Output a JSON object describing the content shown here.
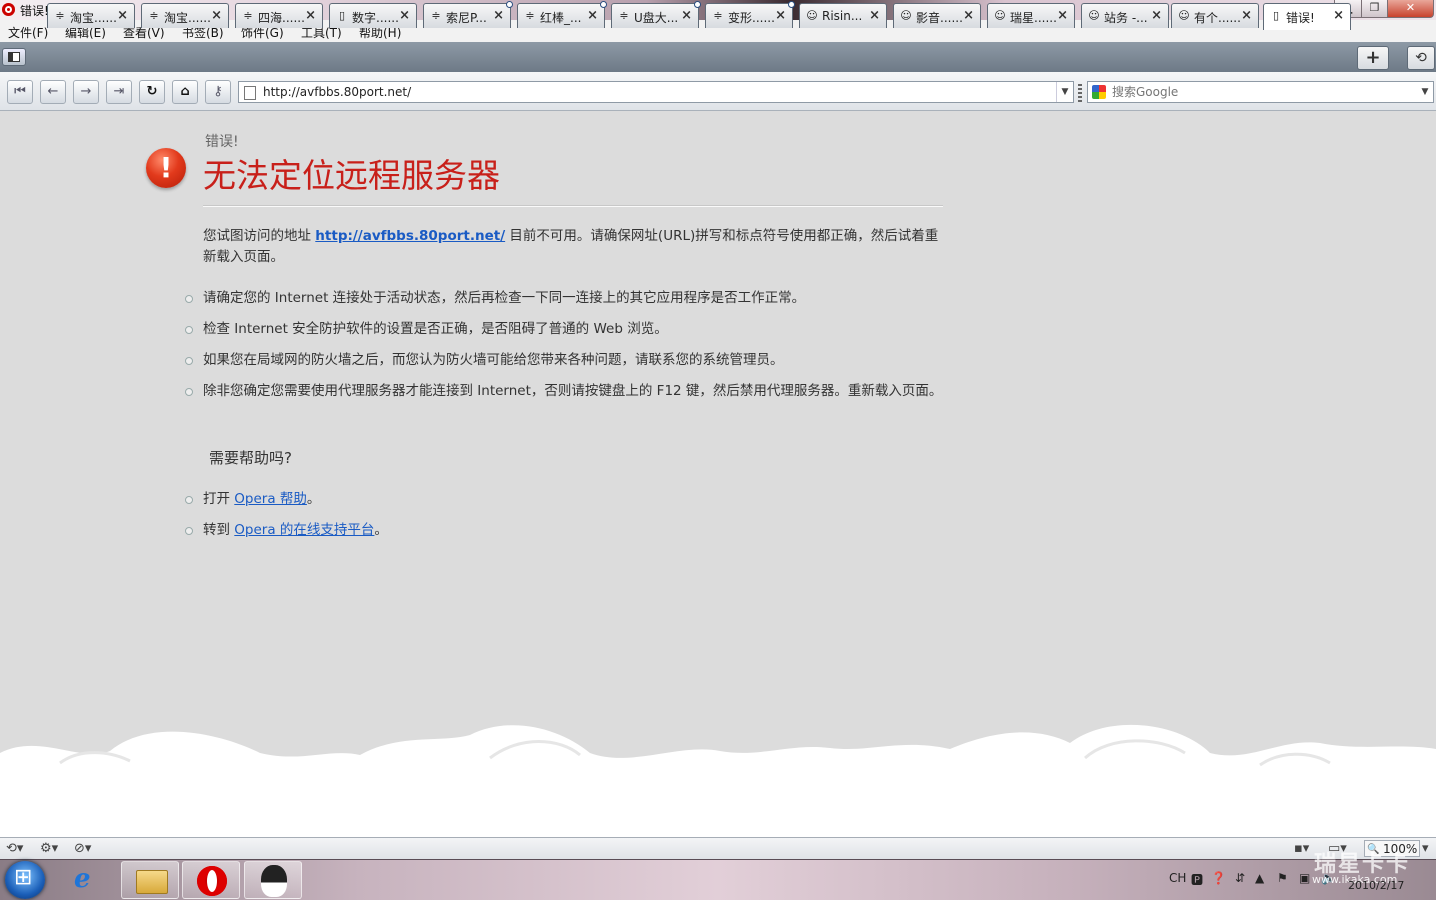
{
  "window": {
    "title": "错误! - Opera"
  },
  "menu": [
    "文件(F)",
    "编辑(E)",
    "查看(V)",
    "书签(B)",
    "饰件(G)",
    "工具(T)",
    "帮助(H)"
  ],
  "tabs": [
    {
      "label": "淘宝......",
      "icon": "feed-icon"
    },
    {
      "label": "淘宝......",
      "icon": "feed-icon"
    },
    {
      "label": "四海......",
      "icon": "feed-icon"
    },
    {
      "label": "数字......",
      "icon": "page-icon"
    },
    {
      "label": "索尼P...",
      "icon": "feed-icon"
    },
    {
      "label": "红棒_...",
      "icon": "feed-icon"
    },
    {
      "label": "U盘大...",
      "icon": "feed-icon"
    },
    {
      "label": "变形......",
      "icon": "feed-icon"
    },
    {
      "label": "Risin...",
      "icon": "smiley-icon"
    },
    {
      "label": "影音......",
      "icon": "smiley-icon"
    },
    {
      "label": "瑞星......",
      "icon": "smiley-icon"
    },
    {
      "label": "站务 -...",
      "icon": "smiley-icon"
    },
    {
      "label": "有个......",
      "icon": "smiley-icon"
    },
    {
      "label": "错误!",
      "icon": "page-icon",
      "active": true
    }
  ],
  "tabs_overflow": "•••",
  "address": {
    "url": "http://avfbbs.80port.net/"
  },
  "search": {
    "placeholder": "搜索Google"
  },
  "error_page": {
    "small_label": "错误!",
    "title": "无法定位远程服务器",
    "intro_before": "您试图访问的地址 ",
    "intro_link": "http://avfbbs.80port.net/",
    "intro_after": " 目前不可用。请确保网址(URL)拼写和标点符号使用都正确，然后试着重新载入页面。",
    "tips": [
      "请确定您的 Internet 连接处于活动状态，然后再检查一下同一连接上的其它应用程序是否工作正常。",
      "检查 Internet 安全防护软件的设置是否正确，是否阻碍了普通的 Web 浏览。",
      "如果您在局域网的防火墙之后，而您认为防火墙可能给您带来各种问题，请联系您的系统管理员。",
      "除非您确定您需要使用代理服务器才能连接到 Internet，否则请按键盘上的 F12 键，然后禁用代理服务器。重新载入页面。"
    ],
    "help_heading": "需要帮助吗?",
    "help_items": [
      {
        "prefix": "打开 ",
        "link": "Opera 帮助",
        "suffix": "。"
      },
      {
        "prefix": "转到 ",
        "link": "Opera 的在线支持平台",
        "suffix": "。"
      }
    ]
  },
  "status": {
    "zoom": "100%"
  },
  "tray": {
    "lang": "CH",
    "clock_date": "2010/2/17",
    "watermark_cn": "瑞星卡卡",
    "watermark_url": "www.ikaka.com"
  },
  "colors": {
    "error_red": "#c8201a",
    "link_blue": "#1a5bc4",
    "page_bg": "#dcdcdc"
  }
}
